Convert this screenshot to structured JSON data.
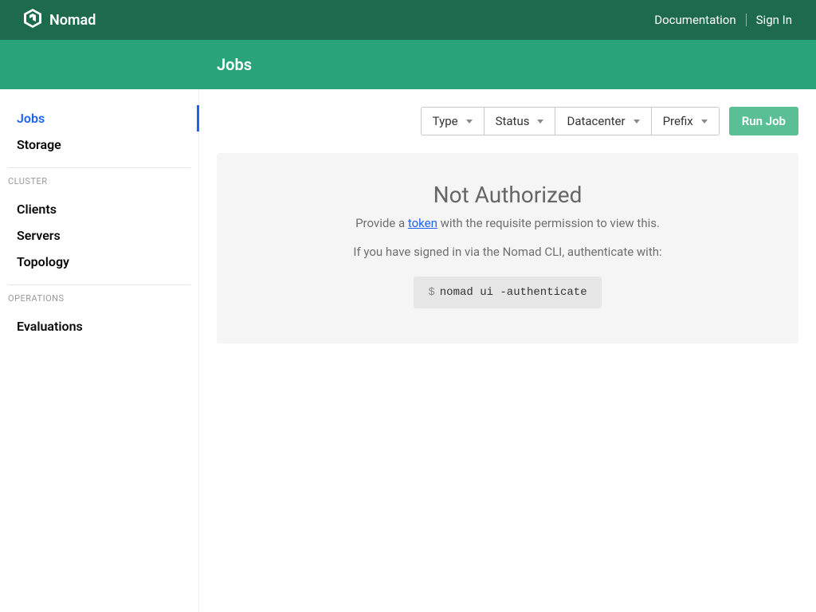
{
  "brand": {
    "name": "Nomad"
  },
  "topbar": {
    "documentation": "Documentation",
    "signin": "Sign In"
  },
  "subheader": {
    "title": "Jobs"
  },
  "sidebar": {
    "items_top": [
      {
        "label": "Jobs",
        "active": true
      },
      {
        "label": "Storage",
        "active": false
      }
    ],
    "section_cluster_title": "CLUSTER",
    "items_cluster": [
      {
        "label": "Clients"
      },
      {
        "label": "Servers"
      },
      {
        "label": "Topology"
      }
    ],
    "section_operations_title": "OPERATIONS",
    "items_operations": [
      {
        "label": "Evaluations"
      }
    ]
  },
  "filters": [
    {
      "label": "Type"
    },
    {
      "label": "Status"
    },
    {
      "label": "Datacenter"
    },
    {
      "label": "Prefix"
    }
  ],
  "run_job_label": "Run Job",
  "error": {
    "title": "Not Authorized",
    "provide_prefix": "Provide a ",
    "token_link": "token",
    "provide_suffix": " with the requisite permission to view this.",
    "cli_hint": "If you have signed in via the Nomad CLI, authenticate with:",
    "command_prompt": "$",
    "command": "nomad ui -authenticate"
  },
  "colors": {
    "topbar_bg": "#1e6a4d",
    "subheader_bg": "#29a37a",
    "link_blue": "#1d63f2",
    "run_btn_bg": "#5bbf96"
  }
}
